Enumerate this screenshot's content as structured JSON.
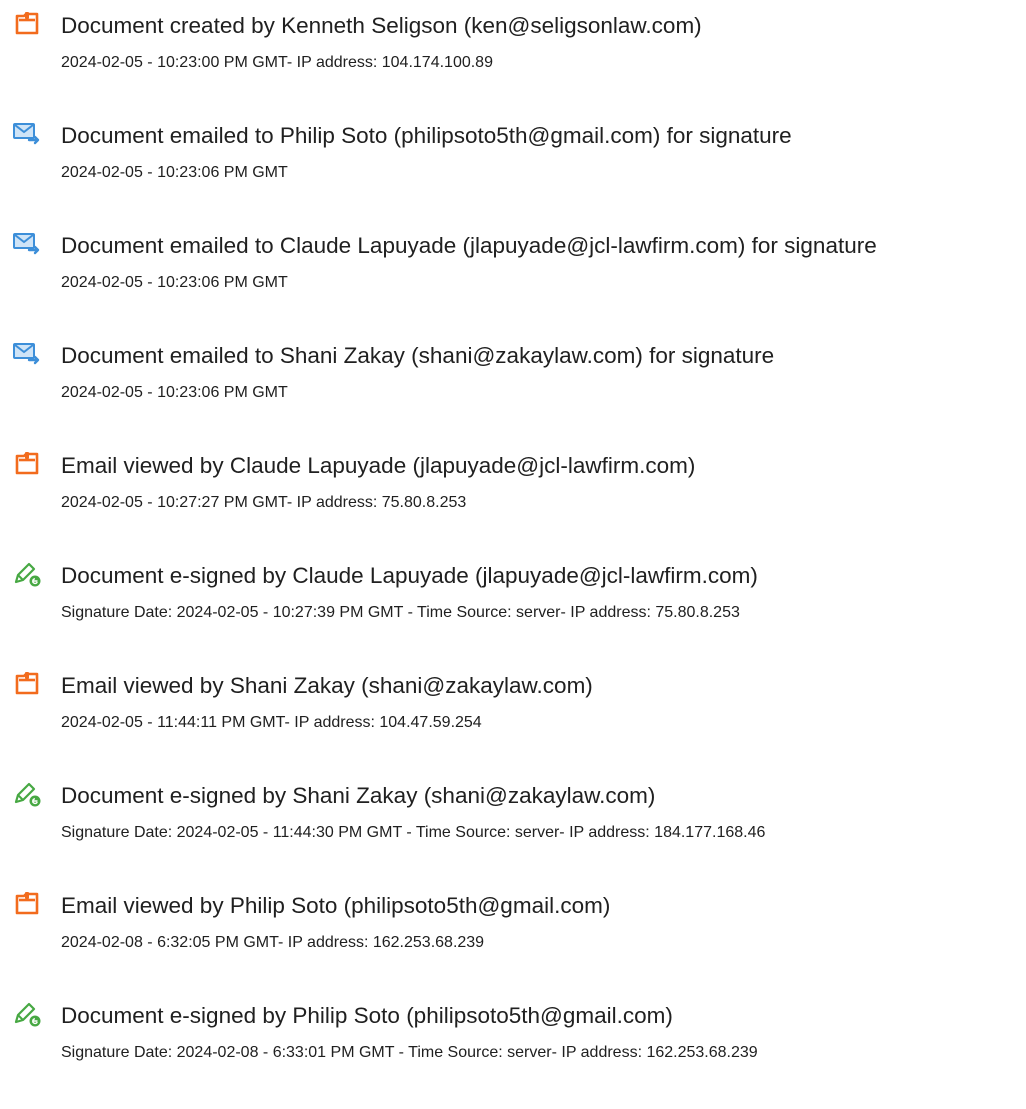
{
  "entries": [
    {
      "icon": "document-created-icon",
      "title": "Document created by Kenneth Seligson (ken@seligsonlaw.com)",
      "detail": "2024-02-05 - 10:23:00 PM GMT- IP address: 104.174.100.89"
    },
    {
      "icon": "email-sent-icon",
      "title": "Document emailed to Philip Soto (philipsoto5th@gmail.com) for signature",
      "detail": "2024-02-05 - 10:23:06 PM GMT"
    },
    {
      "icon": "email-sent-icon",
      "title": "Document emailed to Claude Lapuyade (jlapuyade@jcl-lawfirm.com) for signature",
      "detail": "2024-02-05 - 10:23:06 PM GMT"
    },
    {
      "icon": "email-sent-icon",
      "title": "Document emailed to Shani Zakay (shani@zakaylaw.com) for signature",
      "detail": "2024-02-05 - 10:23:06 PM GMT"
    },
    {
      "icon": "document-viewed-icon",
      "title": "Email viewed by Claude Lapuyade (jlapuyade@jcl-lawfirm.com)",
      "detail": "2024-02-05 - 10:27:27 PM GMT- IP address: 75.80.8.253"
    },
    {
      "icon": "e-sign-icon",
      "title": "Document e-signed by Claude Lapuyade (jlapuyade@jcl-lawfirm.com)",
      "detail": "Signature Date: 2024-02-05 - 10:27:39 PM GMT - Time Source: server- IP address: 75.80.8.253"
    },
    {
      "icon": "document-viewed-icon",
      "title": "Email viewed by Shani Zakay (shani@zakaylaw.com)",
      "detail": "2024-02-05 - 11:44:11 PM GMT- IP address: 104.47.59.254"
    },
    {
      "icon": "e-sign-icon",
      "title": "Document e-signed by Shani Zakay (shani@zakaylaw.com)",
      "detail": "Signature Date: 2024-02-05 - 11:44:30 PM GMT - Time Source: server- IP address: 184.177.168.46"
    },
    {
      "icon": "document-viewed-icon",
      "title": "Email viewed by Philip Soto (philipsoto5th@gmail.com)",
      "detail": "2024-02-08 - 6:32:05 PM GMT- IP address: 162.253.68.239"
    },
    {
      "icon": "e-sign-icon",
      "title": "Document e-signed by Philip Soto (philipsoto5th@gmail.com)",
      "detail": "Signature Date: 2024-02-08 - 6:33:01 PM GMT - Time Source: server- IP address: 162.253.68.239"
    }
  ],
  "colors": {
    "document_icon_orange": "#f26b1d",
    "email_icon_blue": "#3d8fd9",
    "sign_icon_green": "#47a843",
    "text": "#202020"
  }
}
